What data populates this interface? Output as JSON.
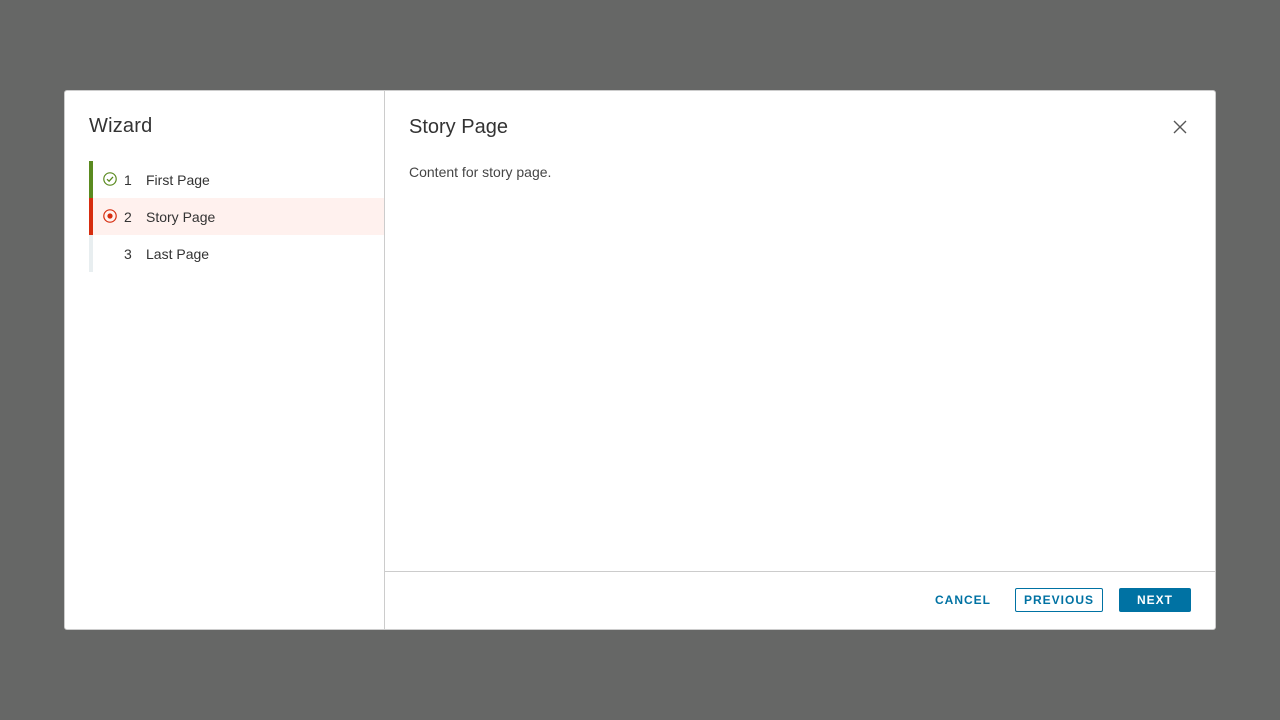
{
  "wizard": {
    "title": "Wizard",
    "steps": [
      {
        "number": "1",
        "label": "First Page",
        "state": "done",
        "icon": "check-circle-icon"
      },
      {
        "number": "2",
        "label": "Story Page",
        "state": "current",
        "icon": "dot-circle-icon"
      },
      {
        "number": "3",
        "label": "Last Page",
        "state": "pending",
        "icon": ""
      }
    ]
  },
  "page": {
    "title": "Story Page",
    "body": "Content for story page."
  },
  "footer": {
    "cancel_label": "CANCEL",
    "previous_label": "PREVIOUS",
    "next_label": "NEXT"
  },
  "colors": {
    "primary": "#0072a3",
    "done": "#5a8a1f",
    "current": "#d62d0f",
    "current_bg": "#fff1ee",
    "backdrop": "#666766"
  }
}
